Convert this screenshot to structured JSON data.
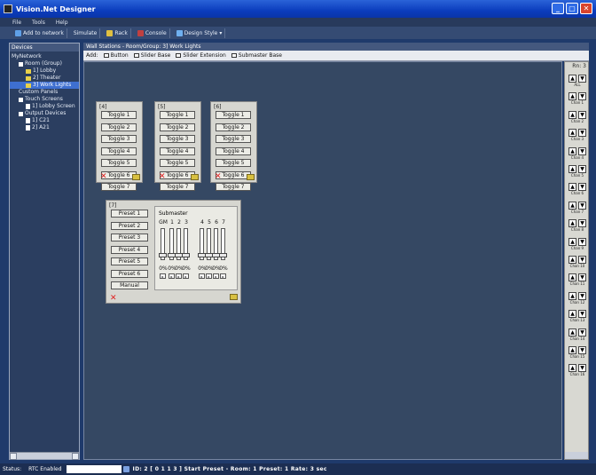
{
  "window": {
    "title": "Vision.Net Designer"
  },
  "menu": [
    "File",
    "Tools",
    "Help"
  ],
  "toolbar": {
    "items": [
      "Add to network",
      "Simulate",
      "Rack",
      "Console",
      "Design Style"
    ]
  },
  "sidebar": {
    "header": "Devices",
    "tree": [
      {
        "label": "MyNetwork"
      },
      {
        "label": "Room (Group)"
      },
      {
        "label": "1] Lobby"
      },
      {
        "label": "2] Theater"
      },
      {
        "label": "3] Work Lights",
        "selected": true
      },
      {
        "label": "Custom Panels"
      },
      {
        "label": "Touch Screens"
      },
      {
        "label": "1] Lobby Screen"
      },
      {
        "label": "Output Devices"
      },
      {
        "label": "1] C21"
      },
      {
        "label": "2] A21"
      }
    ]
  },
  "main": {
    "title": "Wall Stations - Room/Group: 3] Work Lights",
    "add_label": "Add:",
    "add_items": [
      "Button",
      "Slider Base",
      "Slider Extension",
      "Submaster Base"
    ],
    "panels": [
      {
        "number": "[4]",
        "buttons": [
          "Toggle 1",
          "Toggle 2",
          "Toggle 3",
          "Toggle 4",
          "Toggle 5",
          "Toggle 6",
          "Toggle 7"
        ]
      },
      {
        "number": "[5]",
        "buttons": [
          "Toggle 1",
          "Toggle 2",
          "Toggle 3",
          "Toggle 4",
          "Toggle 5",
          "Toggle 6",
          "Toggle 7"
        ]
      },
      {
        "number": "[6]",
        "buttons": [
          "Toggle 1",
          "Toggle 2",
          "Toggle 3",
          "Toggle 4",
          "Toggle 5",
          "Toggle 6",
          "Toggle 7"
        ]
      }
    ],
    "preset_panel": {
      "number": "[7]",
      "buttons": [
        "Preset 1",
        "Preset 2",
        "Preset 3",
        "Preset 4",
        "Preset 5",
        "Preset 6",
        "Manual"
      ],
      "submaster_title": "Submaster",
      "channels": [
        "GM",
        "1",
        "2",
        "3",
        "4",
        "5",
        "6",
        "7"
      ],
      "levels": [
        "0%",
        "0%",
        "0%",
        "0%",
        "0%",
        "0%",
        "0%",
        "0%"
      ]
    }
  },
  "rack": {
    "header": "Rn: 3",
    "labels": [
      "ALL",
      "Chan 1",
      "Chan 2",
      "Chan 3",
      "Chan 4",
      "Chan 5",
      "Chan 6",
      "Chan 7",
      "Chan 8",
      "Chan 9",
      "Chan 10",
      "Chan 11",
      "Chan 12",
      "Chan 13",
      "Chan 14",
      "Chan 15",
      "Chan 16"
    ]
  },
  "status": {
    "label": "Status:",
    "rtc": "RTC Enabled",
    "message": "ID: 2 [ 0 1 1 3 ] Start Preset - Room: 1 Preset: 1 Rate: 3 sec"
  }
}
